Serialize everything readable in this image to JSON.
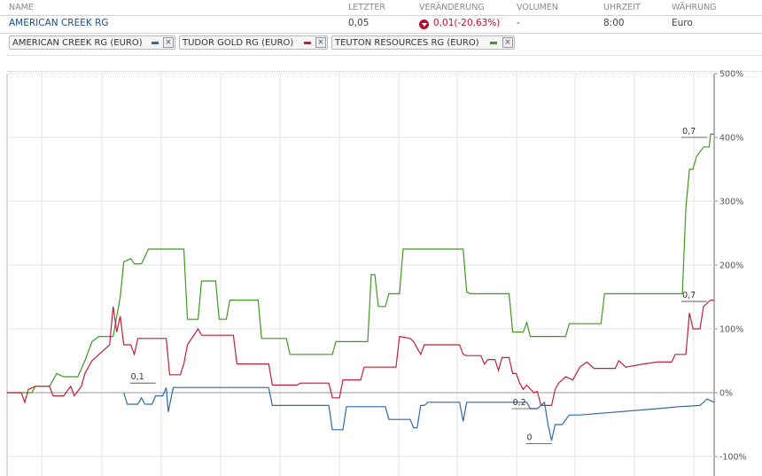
{
  "table": {
    "headers": [
      "NAME",
      "LETZTER",
      "VERÄNDERUNG",
      "VOLUMEN",
      "UHRZEIT",
      "WÄHRUNG"
    ],
    "row": {
      "name": "AMERICAN CREEK RG",
      "last": "0,05",
      "change": "0,01(-20,63%)",
      "volume": "-",
      "time": "8:00",
      "currency": "Euro"
    }
  },
  "chips": [
    {
      "label": "AMERICAN CREEK RG (EURO)",
      "color": "#2f6aa6",
      "close": "×"
    },
    {
      "label": "TUDOR GOLD RG (EURO)",
      "color": "#c0203a",
      "close": "×"
    },
    {
      "label": "TEUTON RESOURCES RG (EURO)",
      "color": "#3f9a1f",
      "close": "×"
    }
  ],
  "colors": {
    "blue": "#2f6aa6",
    "red": "#c0203a",
    "green": "#3f9a1f",
    "down": "#b0102a"
  },
  "chart_data": {
    "type": "line",
    "ylim": [
      -130,
      500
    ],
    "xlim": [
      0,
      100
    ],
    "yticks": [
      {
        "v": 500,
        "label": "500%"
      },
      {
        "v": 400,
        "label": "400%"
      },
      {
        "v": 300,
        "label": "300%"
      },
      {
        "v": 200,
        "label": "200%"
      },
      {
        "v": 100,
        "label": "100%"
      },
      {
        "v": 0,
        "label": "0%"
      },
      {
        "v": -100,
        "label": "-100%"
      }
    ],
    "grid": true,
    "series": [
      {
        "color": "#3f9a1f",
        "points": [
          [
            0,
            0
          ],
          [
            3.5,
            0
          ],
          [
            4,
            10
          ],
          [
            6,
            10
          ],
          [
            7,
            30
          ],
          [
            8,
            25
          ],
          [
            10,
            25
          ],
          [
            11,
            50
          ],
          [
            12,
            80
          ],
          [
            13,
            88
          ],
          [
            15,
            88
          ],
          [
            16,
            150
          ],
          [
            16.5,
            205
          ],
          [
            17.5,
            210
          ],
          [
            18,
            202
          ],
          [
            19,
            202
          ],
          [
            20,
            225
          ],
          [
            25,
            225
          ],
          [
            25.5,
            115
          ],
          [
            27,
            115
          ],
          [
            27.5,
            175
          ],
          [
            29.5,
            175
          ],
          [
            30,
            115
          ],
          [
            31,
            115
          ],
          [
            31.5,
            145
          ],
          [
            35.5,
            145
          ],
          [
            36,
            85
          ],
          [
            39.5,
            85
          ],
          [
            40,
            60
          ],
          [
            46,
            60
          ],
          [
            46.5,
            80
          ],
          [
            51,
            80
          ],
          [
            51.5,
            185
          ],
          [
            52,
            185
          ],
          [
            52.5,
            135
          ],
          [
            53.5,
            135
          ],
          [
            54,
            155
          ],
          [
            55.5,
            155
          ],
          [
            56,
            225
          ],
          [
            64.5,
            225
          ],
          [
            65,
            158
          ],
          [
            65.5,
            155
          ],
          [
            71,
            155
          ],
          [
            71.5,
            95
          ],
          [
            73,
            95
          ],
          [
            73.5,
            110
          ],
          [
            74,
            88
          ],
          [
            79,
            88
          ],
          [
            79.5,
            108
          ],
          [
            84,
            108
          ],
          [
            84.5,
            155
          ],
          [
            95.5,
            155
          ],
          [
            96,
            290
          ],
          [
            96.5,
            350
          ],
          [
            97,
            350
          ],
          [
            97.5,
            370
          ],
          [
            98.5,
            385
          ],
          [
            99.3,
            385
          ],
          [
            99.5,
            405
          ],
          [
            100,
            405
          ]
        ]
      },
      {
        "color": "#c0203a",
        "points": [
          [
            0,
            0
          ],
          [
            2,
            0
          ],
          [
            2.5,
            -15
          ],
          [
            3,
            5
          ],
          [
            4,
            10
          ],
          [
            6,
            10
          ],
          [
            6.5,
            -5
          ],
          [
            8,
            -5
          ],
          [
            9,
            10
          ],
          [
            9.5,
            -5
          ],
          [
            10.5,
            10
          ],
          [
            11,
            30
          ],
          [
            12,
            50
          ],
          [
            13,
            60
          ],
          [
            14.5,
            75
          ],
          [
            15,
            135
          ],
          [
            15.5,
            95
          ],
          [
            16,
            120
          ],
          [
            16.5,
            75
          ],
          [
            17.5,
            75
          ],
          [
            18,
            60
          ],
          [
            18.5,
            85
          ],
          [
            22.5,
            85
          ],
          [
            23,
            28
          ],
          [
            24.5,
            28
          ],
          [
            25,
            45
          ],
          [
            25.5,
            75
          ],
          [
            27,
            100
          ],
          [
            27.5,
            90
          ],
          [
            32,
            90
          ],
          [
            32.5,
            45
          ],
          [
            37,
            45
          ],
          [
            37.5,
            12
          ],
          [
            41,
            12
          ],
          [
            41.5,
            15
          ],
          [
            45.5,
            15
          ],
          [
            46,
            -8
          ],
          [
            47,
            -8
          ],
          [
            47.5,
            20
          ],
          [
            50,
            20
          ],
          [
            50.5,
            40
          ],
          [
            55,
            40
          ],
          [
            55.5,
            88
          ],
          [
            57,
            85
          ],
          [
            57.5,
            80
          ],
          [
            58.5,
            60
          ],
          [
            59,
            75
          ],
          [
            64,
            75
          ],
          [
            64.5,
            60
          ],
          [
            65,
            58
          ],
          [
            67,
            58
          ],
          [
            67.5,
            45
          ],
          [
            68,
            52
          ],
          [
            69,
            52
          ],
          [
            69.5,
            35
          ],
          [
            70,
            55
          ],
          [
            71,
            55
          ],
          [
            71.5,
            30
          ],
          [
            72,
            30
          ],
          [
            72.5,
            15
          ],
          [
            73,
            5
          ],
          [
            73.5,
            12
          ],
          [
            74.5,
            0
          ],
          [
            75,
            2
          ],
          [
            75.5,
            -20
          ],
          [
            77,
            -20
          ],
          [
            77.5,
            5
          ],
          [
            78,
            15
          ],
          [
            79,
            25
          ],
          [
            80,
            20
          ],
          [
            81,
            40
          ],
          [
            82,
            48
          ],
          [
            83,
            38
          ],
          [
            86,
            38
          ],
          [
            86.5,
            50
          ],
          [
            87.5,
            40
          ],
          [
            90,
            45
          ],
          [
            92,
            48
          ],
          [
            94,
            48
          ],
          [
            94.5,
            60
          ],
          [
            96,
            60
          ],
          [
            96.5,
            125
          ],
          [
            97,
            100
          ],
          [
            98,
            100
          ],
          [
            98.5,
            135
          ],
          [
            99.5,
            145
          ],
          [
            100,
            145
          ]
        ]
      },
      {
        "color": "#2f6aa6",
        "points": [
          [
            16.5,
            0
          ],
          [
            17,
            -18
          ],
          [
            18.5,
            -18
          ],
          [
            19,
            -8
          ],
          [
            19.5,
            -18
          ],
          [
            20.5,
            -18
          ],
          [
            21,
            -5
          ],
          [
            22,
            -5
          ],
          [
            22.5,
            8
          ],
          [
            22.8,
            -30
          ],
          [
            23.5,
            8
          ],
          [
            37,
            8
          ],
          [
            37.5,
            -20
          ],
          [
            45.5,
            -20
          ],
          [
            46,
            -58
          ],
          [
            47.5,
            -58
          ],
          [
            48,
            -22
          ],
          [
            53.5,
            -22
          ],
          [
            54,
            -42
          ],
          [
            57,
            -42
          ],
          [
            57.5,
            -55
          ],
          [
            58,
            -55
          ],
          [
            58.5,
            -20
          ],
          [
            59,
            -20
          ],
          [
            59.5,
            -15
          ],
          [
            64,
            -15
          ],
          [
            64.5,
            -45
          ],
          [
            65,
            -15
          ],
          [
            73.5,
            -15
          ],
          [
            74,
            -25
          ],
          [
            75,
            -25
          ],
          [
            76,
            -15
          ],
          [
            76.5,
            -50
          ],
          [
            77,
            -75
          ],
          [
            77.5,
            -50
          ],
          [
            78.5,
            -50
          ],
          [
            79.5,
            -35
          ],
          [
            80.5,
            -35
          ],
          [
            81,
            -35
          ],
          [
            92,
            -25
          ],
          [
            95,
            -22
          ],
          [
            98,
            -20
          ],
          [
            99,
            -10
          ],
          [
            100,
            -15
          ]
        ]
      }
    ],
    "annotations": [
      {
        "label": "0,7",
        "x": 95.5,
        "y": 400
      },
      {
        "label": "0,7",
        "x": 95.5,
        "y": 143
      },
      {
        "label": "0,1",
        "x": 17.5,
        "y": 15
      },
      {
        "label": "0,2",
        "x": 71.5,
        "y": -25
      },
      {
        "label": "0",
        "x": 73.5,
        "y": -80
      }
    ]
  }
}
